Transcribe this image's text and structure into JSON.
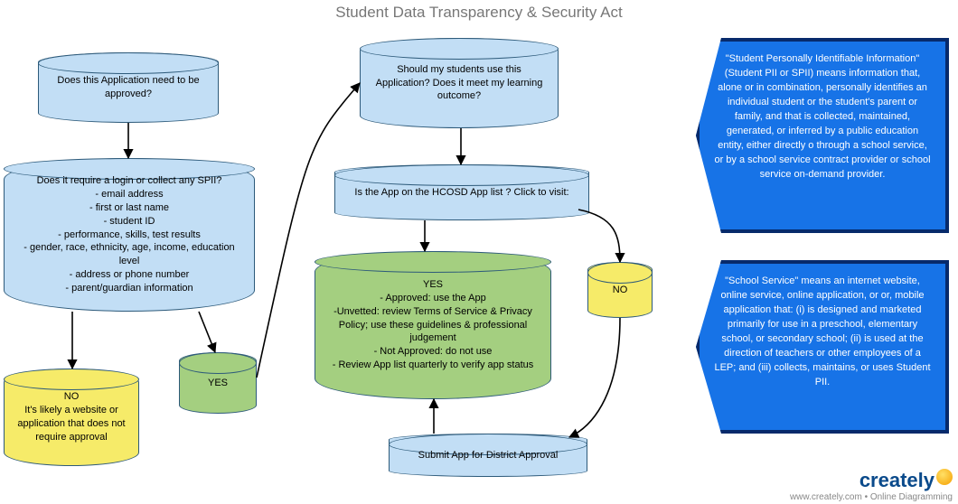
{
  "title": "Student Data Transparency & Security Act",
  "nodes": {
    "q_approve": "Does this Application need to be approved?",
    "q_spii": "Does it require a login or collect any SPII?\n- email address\n- first or last name\n- student ID\n- performance, skills, test results\n- gender, race, ethnicity, age, income, education level\n- address or phone number\n- parent/guardian information",
    "no_approval": "NO\nIt's likely a website or application that does not require approval",
    "yes_small": "YES",
    "q_outcome": "Should my students use this Application?  Does it meet my learning outcome?",
    "q_applist": "Is the  App on the HCOSD App list ?  Click to visit:",
    "yes_guidance": "YES\n- Approved:  use the App\n-Unvetted:  review Terms of Service & Privacy Policy; use these guidelines & professional judgement\n- Not Approved:  do not use\n- Review App list quarterly to verify app status",
    "no_small": "NO",
    "submit": "Submit App for District Approval"
  },
  "panels": {
    "spii_def": "\"Student Personally Identifiable Information\"  (Student PII or SPII) means information that, alone or in combination, personally identifies an individual student or the student's parent or family, and that is collected, maintained, generated, or inferred by a public education entity, either directly o through a school service, or by a school service contract provider or school service on-demand provider.",
    "service_def": "\"School Service\" means an internet website, online service, online application, or or, mobile application that: (i) is designed and marketed primarily for use in a preschool, elementary school, or secondary school; (ii) is used at the direction of teachers or other employees of a LEP; and (iii) collects, maintains, or uses Student PII."
  },
  "logo": {
    "name": "creately",
    "sub": "www.creately.com • Online Diagramming"
  }
}
